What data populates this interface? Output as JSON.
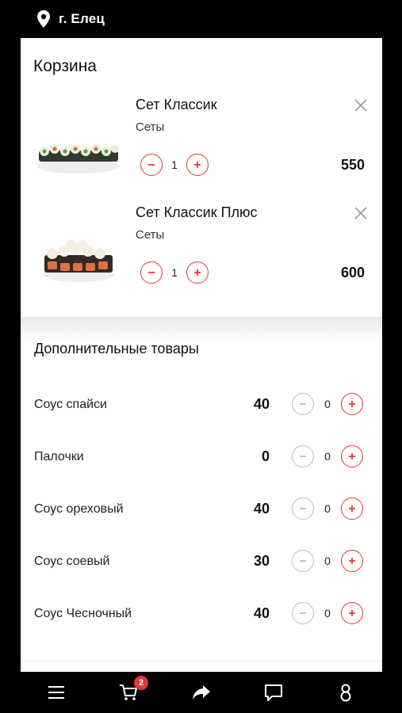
{
  "header": {
    "city": "г. Елец",
    "location_icon": "map-pin-icon"
  },
  "cart": {
    "title": "Корзина",
    "items": [
      {
        "name": "Сет Классик",
        "category": "Сеты",
        "quantity": "1",
        "price": "550"
      },
      {
        "name": "Сет Классик Плюс",
        "category": "Сеты",
        "quantity": "1",
        "price": "600"
      }
    ]
  },
  "extras": {
    "title": "Дополнительные товары",
    "items": [
      {
        "name": "Соус спайси",
        "price": "40",
        "quantity": "0"
      },
      {
        "name": "Палочки",
        "price": "0",
        "quantity": "0"
      },
      {
        "name": "Соус ореховый",
        "price": "40",
        "quantity": "0"
      },
      {
        "name": "Соус соевый",
        "price": "30",
        "quantity": "0"
      },
      {
        "name": "Соус Чесночный",
        "price": "40",
        "quantity": "0"
      }
    ]
  },
  "tabbar": {
    "cart_badge": "2",
    "icons": [
      "menu-icon",
      "cart-icon",
      "share-icon",
      "chat-icon",
      "profile-icon"
    ]
  },
  "colors": {
    "accent": "#e53935",
    "background": "#000000",
    "sheet": "#ffffff"
  }
}
